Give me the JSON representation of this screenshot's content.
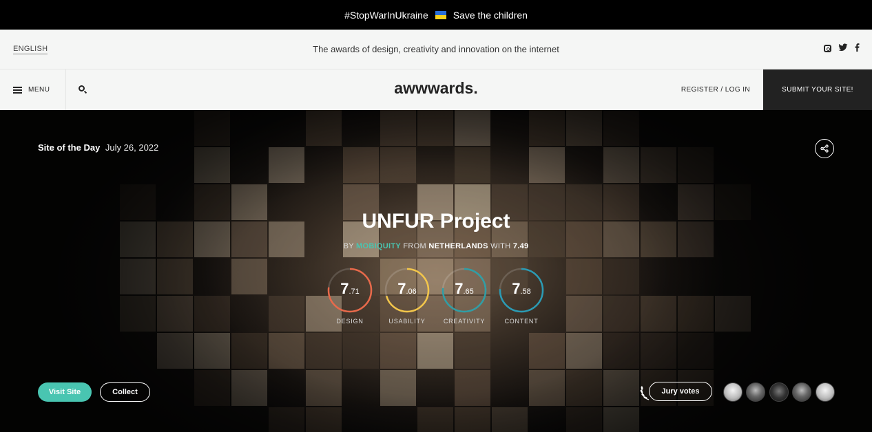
{
  "banner": {
    "text_left": "#StopWarInUkraine",
    "text_right": "Save the children"
  },
  "subbar": {
    "language": "ENGLISH",
    "tagline": "The awards of design, creativity and innovation on the internet",
    "social_icons": [
      "instagram-icon",
      "twitter-icon",
      "facebook-icon"
    ]
  },
  "nav": {
    "menu_label": "MENU",
    "logo": "awwwards.",
    "register_label": "REGISTER / LOG IN",
    "submit_label": "SUBMIT YOUR SITE!"
  },
  "hero": {
    "award": "Site of the Day",
    "date": "July 26, 2022",
    "title": "UNFUR Project",
    "by_prefix": "BY",
    "maker": "MOBIQUITY",
    "from_prefix": "FROM",
    "country": "NETHERLANDS",
    "with_prefix": "WITH",
    "overall_score": "7.49",
    "scores": [
      {
        "label": "DESIGN",
        "whole": "7",
        "decimal": ".71",
        "value": 7.71,
        "color": "#e8694a"
      },
      {
        "label": "USABILITY",
        "whole": "7",
        "decimal": ".06",
        "value": 7.06,
        "color": "#f3c64a"
      },
      {
        "label": "CREATIVITY",
        "whole": "7",
        "decimal": ".65",
        "value": 7.65,
        "color": "#2f9ea6"
      },
      {
        "label": "CONTENT",
        "whole": "7",
        "decimal": ".58",
        "value": 7.58,
        "color": "#2a9bb5"
      }
    ],
    "visit_label": "Visit Site",
    "collect_label": "Collect",
    "jury_label": "Jury votes",
    "jury_count": 5
  },
  "colors": {
    "accent": "#49c5b1",
    "banner_bg": "#000000",
    "submit_bg": "#222222"
  }
}
